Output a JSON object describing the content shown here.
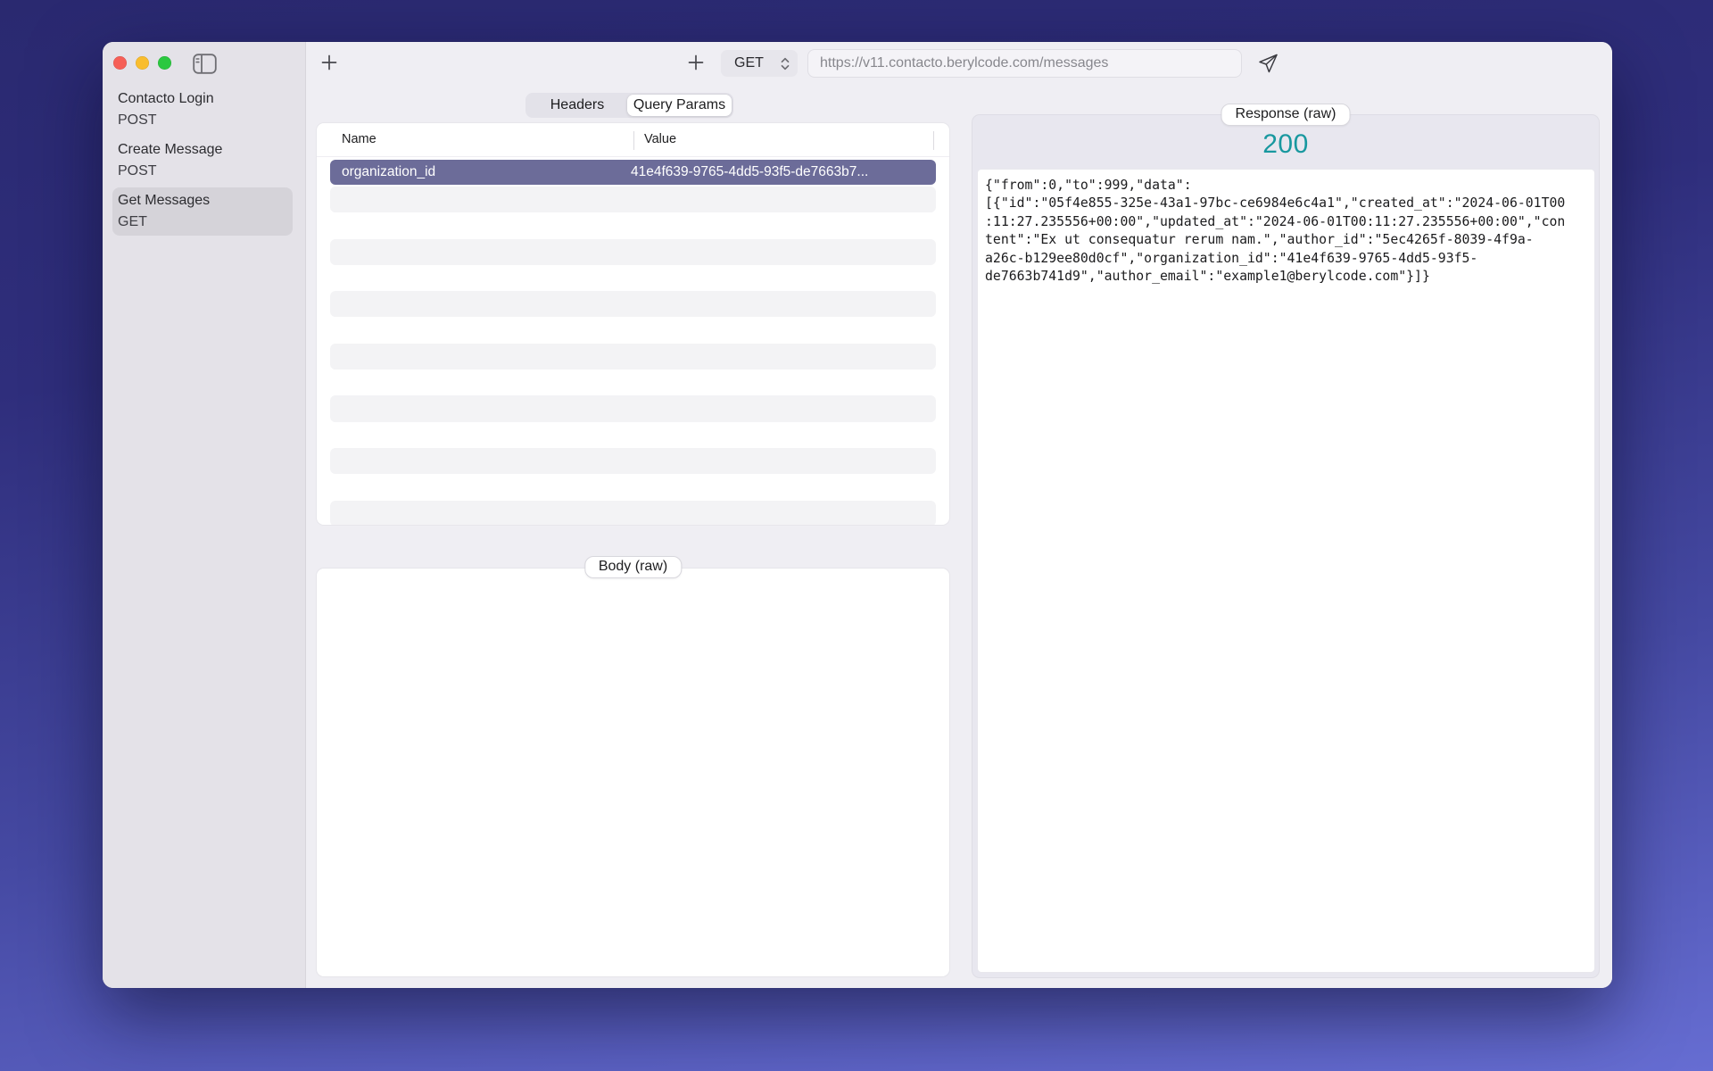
{
  "sidebar": {
    "items": [
      {
        "name": "Contacto Login",
        "method": "POST",
        "selected": false
      },
      {
        "name": "Create Message",
        "method": "POST",
        "selected": false
      },
      {
        "name": "Get Messages",
        "method": "GET",
        "selected": true
      }
    ]
  },
  "toolbar": {
    "method": "GET",
    "url": "https://v11.contacto.berylcode.com/messages"
  },
  "request": {
    "tabs": [
      {
        "label": "Headers",
        "selected": false
      },
      {
        "label": "Query Params",
        "selected": true
      }
    ],
    "params_table": {
      "columns": {
        "name": "Name",
        "value": "Value"
      },
      "rows": [
        {
          "name": "organization_id",
          "value": "41e4f639-9765-4dd5-93f5-de7663b7...",
          "selected": true
        }
      ],
      "empty_row_count": 13
    },
    "body_badge": "Body (raw)"
  },
  "response": {
    "badge": "Response (raw)",
    "status_code": "200",
    "body_lines": [
      "{\"from\":0,\"to\":999,\"data\":",
      "[{\"id\":\"05f4e855-325e-43a1-97bc-ce6984e6c4a1\",\"created_at\":\"2024-06-01T00",
      ":11:27.235556+00:00\",\"updated_at\":\"2024-06-01T00:11:27.235556+00:00\",\"con",
      "tent\":\"Ex ut consequatur rerum nam.\",\"author_id\":\"5ec4265f-8039-4f9a-",
      "a26c-b129ee80d0cf\",\"organization_id\":\"41e4f639-9765-4dd5-93f5-",
      "de7663b741d9\",\"author_email\":\"example1@berylcode.com\"}]}"
    ]
  },
  "colors": {
    "status_ok": "#18989f",
    "selected_row": "#6c6c99",
    "traffic_lights": [
      "#f65f57",
      "#f9bd2e",
      "#2bc840"
    ],
    "desktop_gradient_top": "#2a2970",
    "desktop_gradient_bottom": "#666dd2"
  },
  "icons": {
    "sidebar_toggle": "sidebar-panel-icon",
    "add_request": "plus-icon",
    "add_tab": "plus-icon",
    "method_selector": "chevron-up-down-icon",
    "send": "paper-plane-icon"
  }
}
